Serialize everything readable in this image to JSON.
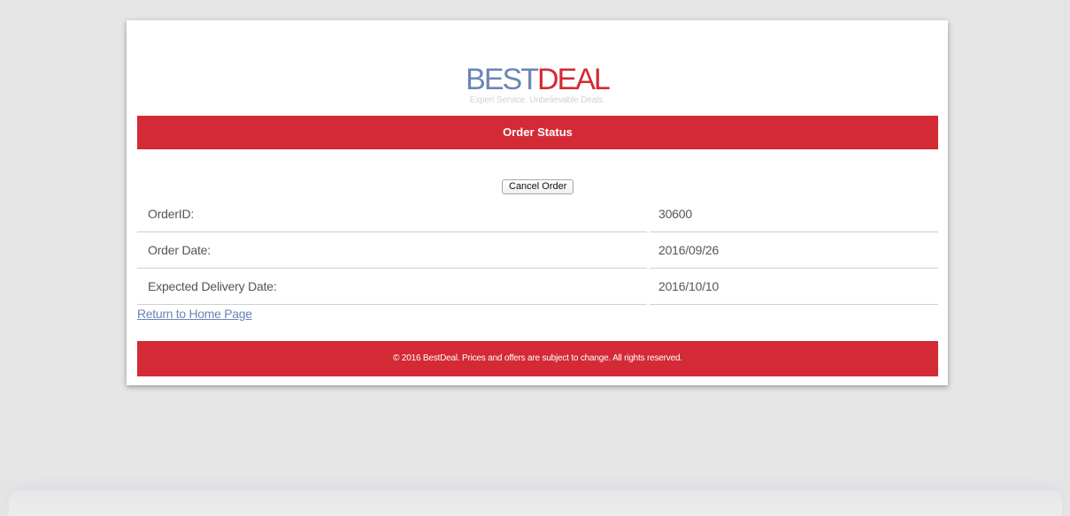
{
  "brand": {
    "logo_best": "BEST",
    "logo_deal": "DEAL",
    "tagline": "Expert Service. Unbelievable Deals."
  },
  "header": {
    "title": "Order Status"
  },
  "actions": {
    "cancel_label": "Cancel Order"
  },
  "order": {
    "rows": [
      {
        "label": "OrderID:",
        "value": "30600"
      },
      {
        "label": "Order Date:",
        "value": "2016/09/26"
      },
      {
        "label": "Expected Delivery Date:",
        "value": "2016/10/10"
      }
    ]
  },
  "links": {
    "return_home": "Return to Home Page"
  },
  "footer": {
    "text": "© 2016 BestDeal. Prices and offers are subject to change. All rights reserved."
  },
  "colors": {
    "brand_red": "#d32a35",
    "brand_blue": "#6b85b8"
  }
}
